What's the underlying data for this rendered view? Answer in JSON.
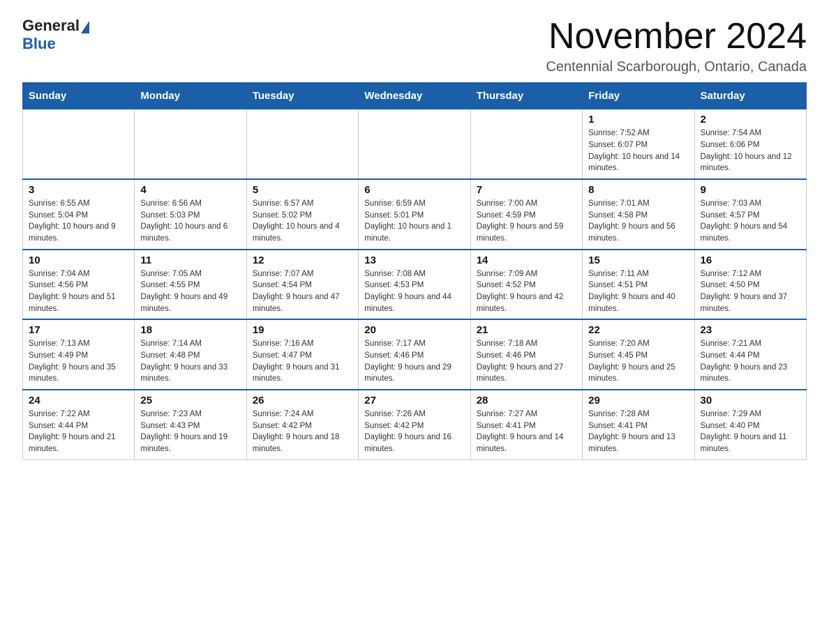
{
  "logo": {
    "general": "General",
    "blue": "Blue"
  },
  "title": "November 2024",
  "location": "Centennial Scarborough, Ontario, Canada",
  "days_of_week": [
    "Sunday",
    "Monday",
    "Tuesday",
    "Wednesday",
    "Thursday",
    "Friday",
    "Saturday"
  ],
  "weeks": [
    [
      {
        "day": "",
        "sunrise": "",
        "sunset": "",
        "daylight": ""
      },
      {
        "day": "",
        "sunrise": "",
        "sunset": "",
        "daylight": ""
      },
      {
        "day": "",
        "sunrise": "",
        "sunset": "",
        "daylight": ""
      },
      {
        "day": "",
        "sunrise": "",
        "sunset": "",
        "daylight": ""
      },
      {
        "day": "",
        "sunrise": "",
        "sunset": "",
        "daylight": ""
      },
      {
        "day": "1",
        "sunrise": "Sunrise: 7:52 AM",
        "sunset": "Sunset: 6:07 PM",
        "daylight": "Daylight: 10 hours and 14 minutes."
      },
      {
        "day": "2",
        "sunrise": "Sunrise: 7:54 AM",
        "sunset": "Sunset: 6:06 PM",
        "daylight": "Daylight: 10 hours and 12 minutes."
      }
    ],
    [
      {
        "day": "3",
        "sunrise": "Sunrise: 6:55 AM",
        "sunset": "Sunset: 5:04 PM",
        "daylight": "Daylight: 10 hours and 9 minutes."
      },
      {
        "day": "4",
        "sunrise": "Sunrise: 6:56 AM",
        "sunset": "Sunset: 5:03 PM",
        "daylight": "Daylight: 10 hours and 6 minutes."
      },
      {
        "day": "5",
        "sunrise": "Sunrise: 6:57 AM",
        "sunset": "Sunset: 5:02 PM",
        "daylight": "Daylight: 10 hours and 4 minutes."
      },
      {
        "day": "6",
        "sunrise": "Sunrise: 6:59 AM",
        "sunset": "Sunset: 5:01 PM",
        "daylight": "Daylight: 10 hours and 1 minute."
      },
      {
        "day": "7",
        "sunrise": "Sunrise: 7:00 AM",
        "sunset": "Sunset: 4:59 PM",
        "daylight": "Daylight: 9 hours and 59 minutes."
      },
      {
        "day": "8",
        "sunrise": "Sunrise: 7:01 AM",
        "sunset": "Sunset: 4:58 PM",
        "daylight": "Daylight: 9 hours and 56 minutes."
      },
      {
        "day": "9",
        "sunrise": "Sunrise: 7:03 AM",
        "sunset": "Sunset: 4:57 PM",
        "daylight": "Daylight: 9 hours and 54 minutes."
      }
    ],
    [
      {
        "day": "10",
        "sunrise": "Sunrise: 7:04 AM",
        "sunset": "Sunset: 4:56 PM",
        "daylight": "Daylight: 9 hours and 51 minutes."
      },
      {
        "day": "11",
        "sunrise": "Sunrise: 7:05 AM",
        "sunset": "Sunset: 4:55 PM",
        "daylight": "Daylight: 9 hours and 49 minutes."
      },
      {
        "day": "12",
        "sunrise": "Sunrise: 7:07 AM",
        "sunset": "Sunset: 4:54 PM",
        "daylight": "Daylight: 9 hours and 47 minutes."
      },
      {
        "day": "13",
        "sunrise": "Sunrise: 7:08 AM",
        "sunset": "Sunset: 4:53 PM",
        "daylight": "Daylight: 9 hours and 44 minutes."
      },
      {
        "day": "14",
        "sunrise": "Sunrise: 7:09 AM",
        "sunset": "Sunset: 4:52 PM",
        "daylight": "Daylight: 9 hours and 42 minutes."
      },
      {
        "day": "15",
        "sunrise": "Sunrise: 7:11 AM",
        "sunset": "Sunset: 4:51 PM",
        "daylight": "Daylight: 9 hours and 40 minutes."
      },
      {
        "day": "16",
        "sunrise": "Sunrise: 7:12 AM",
        "sunset": "Sunset: 4:50 PM",
        "daylight": "Daylight: 9 hours and 37 minutes."
      }
    ],
    [
      {
        "day": "17",
        "sunrise": "Sunrise: 7:13 AM",
        "sunset": "Sunset: 4:49 PM",
        "daylight": "Daylight: 9 hours and 35 minutes."
      },
      {
        "day": "18",
        "sunrise": "Sunrise: 7:14 AM",
        "sunset": "Sunset: 4:48 PM",
        "daylight": "Daylight: 9 hours and 33 minutes."
      },
      {
        "day": "19",
        "sunrise": "Sunrise: 7:16 AM",
        "sunset": "Sunset: 4:47 PM",
        "daylight": "Daylight: 9 hours and 31 minutes."
      },
      {
        "day": "20",
        "sunrise": "Sunrise: 7:17 AM",
        "sunset": "Sunset: 4:46 PM",
        "daylight": "Daylight: 9 hours and 29 minutes."
      },
      {
        "day": "21",
        "sunrise": "Sunrise: 7:18 AM",
        "sunset": "Sunset: 4:46 PM",
        "daylight": "Daylight: 9 hours and 27 minutes."
      },
      {
        "day": "22",
        "sunrise": "Sunrise: 7:20 AM",
        "sunset": "Sunset: 4:45 PM",
        "daylight": "Daylight: 9 hours and 25 minutes."
      },
      {
        "day": "23",
        "sunrise": "Sunrise: 7:21 AM",
        "sunset": "Sunset: 4:44 PM",
        "daylight": "Daylight: 9 hours and 23 minutes."
      }
    ],
    [
      {
        "day": "24",
        "sunrise": "Sunrise: 7:22 AM",
        "sunset": "Sunset: 4:44 PM",
        "daylight": "Daylight: 9 hours and 21 minutes."
      },
      {
        "day": "25",
        "sunrise": "Sunrise: 7:23 AM",
        "sunset": "Sunset: 4:43 PM",
        "daylight": "Daylight: 9 hours and 19 minutes."
      },
      {
        "day": "26",
        "sunrise": "Sunrise: 7:24 AM",
        "sunset": "Sunset: 4:42 PM",
        "daylight": "Daylight: 9 hours and 18 minutes."
      },
      {
        "day": "27",
        "sunrise": "Sunrise: 7:26 AM",
        "sunset": "Sunset: 4:42 PM",
        "daylight": "Daylight: 9 hours and 16 minutes."
      },
      {
        "day": "28",
        "sunrise": "Sunrise: 7:27 AM",
        "sunset": "Sunset: 4:41 PM",
        "daylight": "Daylight: 9 hours and 14 minutes."
      },
      {
        "day": "29",
        "sunrise": "Sunrise: 7:28 AM",
        "sunset": "Sunset: 4:41 PM",
        "daylight": "Daylight: 9 hours and 13 minutes."
      },
      {
        "day": "30",
        "sunrise": "Sunrise: 7:29 AM",
        "sunset": "Sunset: 4:40 PM",
        "daylight": "Daylight: 9 hours and 11 minutes."
      }
    ]
  ]
}
